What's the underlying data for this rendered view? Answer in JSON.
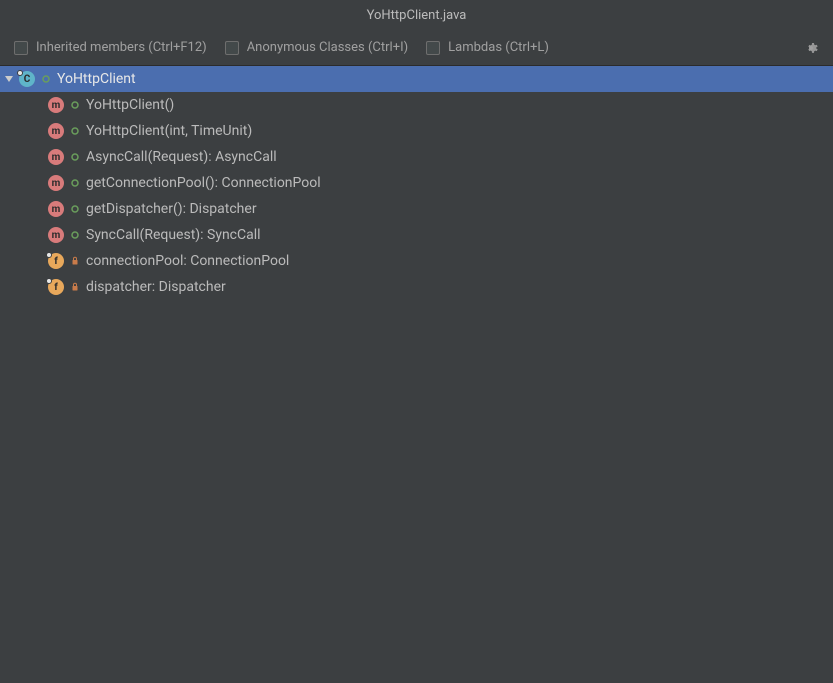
{
  "title": "YoHttpClient.java",
  "toolbar": {
    "inherited_label": "Inherited members (Ctrl+F12)",
    "anonymous_label": "Anonymous Classes (Ctrl+I)",
    "lambdas_label": "Lambdas (Ctrl+L)"
  },
  "root": {
    "label": "YoHttpClient",
    "type": "class",
    "visibility": "public"
  },
  "members": [
    {
      "label": "YoHttpClient()",
      "type": "method",
      "visibility": "public"
    },
    {
      "label": "YoHttpClient(int, TimeUnit)",
      "type": "method",
      "visibility": "public"
    },
    {
      "label": "AsyncCall(Request): AsyncCall",
      "type": "method",
      "visibility": "public"
    },
    {
      "label": "getConnectionPool(): ConnectionPool",
      "type": "method",
      "visibility": "public"
    },
    {
      "label": "getDispatcher(): Dispatcher",
      "type": "method",
      "visibility": "public"
    },
    {
      "label": "SyncCall(Request): SyncCall",
      "type": "method",
      "visibility": "public"
    },
    {
      "label": "connectionPool: ConnectionPool",
      "type": "field",
      "visibility": "private"
    },
    {
      "label": "dispatcher: Dispatcher",
      "type": "field",
      "visibility": "private"
    }
  ]
}
